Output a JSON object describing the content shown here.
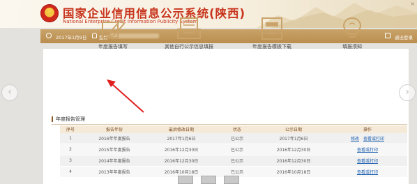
{
  "header": {
    "title_cn": "国家企业信用信息公示系统(陕西)",
    "title_en": "National Enterprise Credit Information Publicity System",
    "close_glyph": "×"
  },
  "toolbar": {
    "date": "2017年1月9日",
    "welcome": "您好",
    "exit_label": "退出登录"
  },
  "menu": [
    {
      "label": "年度报告填写",
      "icon": "pencil-edit-icon"
    },
    {
      "label": "其他自行公示信息填报",
      "icon": "inbox-tray-icon"
    },
    {
      "label": "年度报告模板下载",
      "icon": "template-document-icon"
    },
    {
      "label": "填报须知",
      "icon": "lightbulb-icon"
    }
  ],
  "section_title": "年度报告管理",
  "table": {
    "headers": [
      "序号",
      "报告年份",
      "最后修改日期",
      "状态",
      "公示日期",
      "操作"
    ],
    "rows": [
      {
        "no": "1",
        "year": "2016年年度报告",
        "modified": "2017年1月6日",
        "status": "已公示",
        "published": "2017年1月6日",
        "ops": [
          "修改",
          "查看或打印"
        ]
      },
      {
        "no": "2",
        "year": "2015年年度报告",
        "modified": "2016年12月30日",
        "status": "已公示",
        "published": "2016年12月30日",
        "ops": [
          "查看或打印"
        ]
      },
      {
        "no": "3",
        "year": "2014年年度报告",
        "modified": "2016年12月30日",
        "status": "已公示",
        "published": "2016年12月30日",
        "ops": [
          "查看或打印"
        ]
      },
      {
        "no": "4",
        "year": "2013年年度报告",
        "modified": "2016年10月18日",
        "status": "已公示",
        "published": "2016年10月18日",
        "ops": [
          "查看或打印"
        ]
      }
    ]
  },
  "nav": {
    "prev_glyph": "‹",
    "next_glyph": "›"
  },
  "colors": {
    "brand_red": "#c8351e",
    "bar_gold": "#c9a36a",
    "link_blue": "#1b5fb0",
    "annotation_red": "#e02020"
  }
}
